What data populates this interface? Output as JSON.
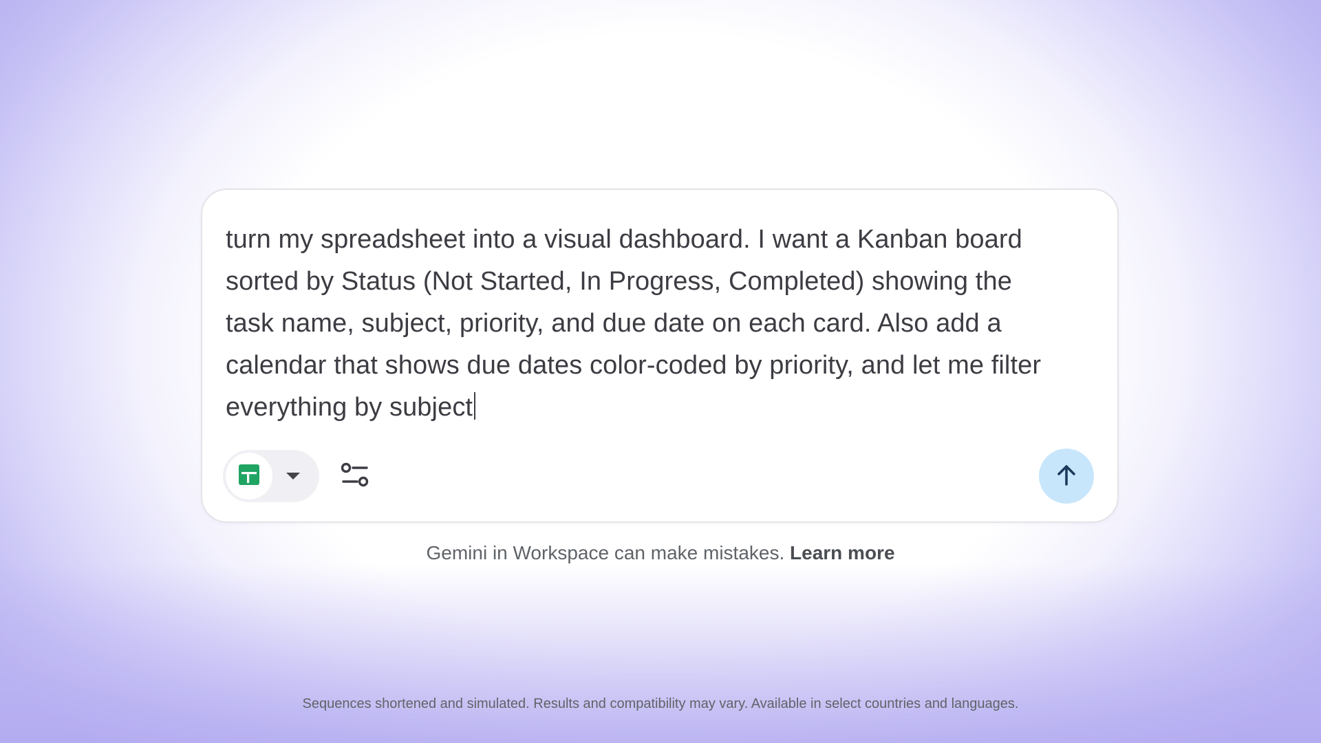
{
  "prompt": {
    "text": "turn my spreadsheet into a visual dashboard. I want a Kanban board sorted by Status (Not Started, In Progress, Completed) showing the task name, subject, priority, and due date on each card. Also add a calendar that shows due dates color-coded by priority, and let me filter everything by subject"
  },
  "toolbar": {
    "source_icon": "sheets-icon",
    "dropdown_icon": "chevron-down-icon",
    "tools_icon": "sliders-icon",
    "send_icon": "arrow-up-icon"
  },
  "disclaimer": {
    "text": "Gemini in Workspace can make mistakes. ",
    "link": "Learn more"
  },
  "footnote": {
    "text": "Sequences shortened and simulated. Results and compatibility may vary. Available in select countries and languages."
  },
  "colors": {
    "sheets_green": "#1fa463",
    "send_button_bg": "#c8e6fb",
    "send_arrow": "#1a3b5c",
    "text": "#3c3c43"
  }
}
